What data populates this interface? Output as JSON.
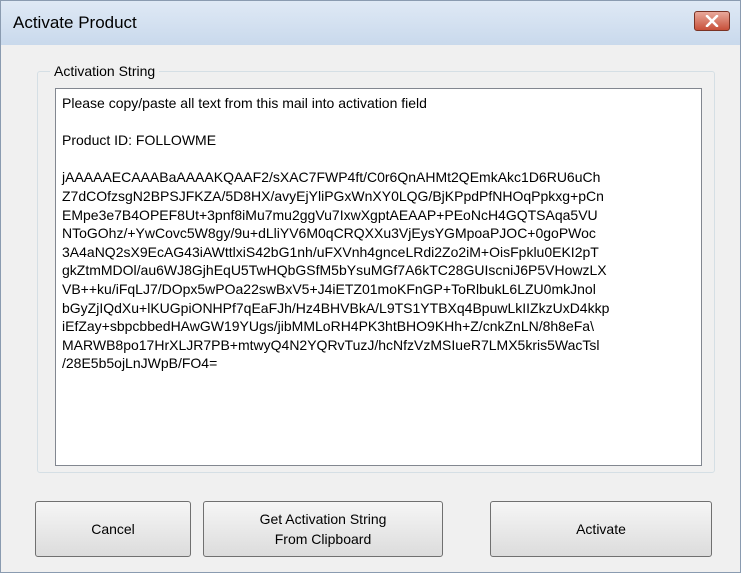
{
  "window": {
    "title": "Activate Product",
    "close_icon": "close-icon"
  },
  "group": {
    "label": "Activation String"
  },
  "activation_field": {
    "text": "Please copy/paste all text from this mail into activation field\n\nProduct ID: FOLLOWME\n\njAAAAAECAAABaAAAAKQAAF2/sXAC7FWP4ft/C0r6QnAHMt2QEmkAkc1D6RU6uCh\nZ7dCOfzsgN2BPSJFKZA/5D8HX/avyEjYliPGxWnXY0LQG/BjKPpdPfNHOqPpkxg+pCn\nEMpe3e7B4OPEF8Ut+3pnf8iMu7mu2ggVu7IxwXgptAEAAP+PEoNcH4GQTSAqa5VU\nNToGOhz/+YwCovc5W8gy/9u+dLliYV6M0qCRQXXu3VjEysYGMpoaPJOC+0goPWoc\n3A4aNQ2sX9EcAG43iAWttlxiS42bG1nh/uFXVnh4gnceLRdi2Zo2iM+OisFpklu0EKI2pT\ngkZtmMDOl/au6WJ8GjhEqU5TwHQbGSfM5bYsuMGf7A6kTC28GUIscniJ6P5VHowzLX\nVB++ku/iFqLJ7/DOpx5wPOa22swBxV5+J4iETZ01moKFnGP+ToRlbukL6LZU0mkJnol\nbGyZjIQdXu+lKUGpiONHPf7qEaFJh/Hz4BHVBkA/L9TS1YTBXq4BpuwLkIIZkzUxD4kkp\niEfZay+sbpcbbedHAwGW19YUgs/jibMMLoRH4PK3htBHO9KHh+Z/cnkZnLN/8h8eFa\\\nMARWB8po17HrXLJR7PB+mtwyQ4N2YQRvTuzJ/hcNfzVzMSIueR7LMX5kris5WacTsl\n/28E5b5ojLnJWpB/FO4="
  },
  "buttons": {
    "cancel": "Cancel",
    "get_from_clipboard": "Get Activation String\nFrom Clipboard",
    "activate": "Activate"
  }
}
